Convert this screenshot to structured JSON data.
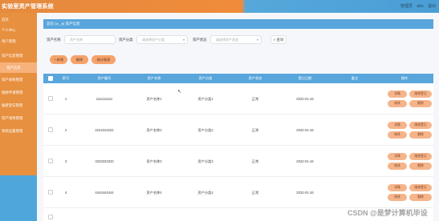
{
  "app": {
    "title": "实验室资产管理系统"
  },
  "user": {
    "role": "管理员",
    "name": "abo",
    "logout": "退出"
  },
  "sidebar": {
    "items": [
      {
        "label": "首页"
      },
      {
        "label": "个人中心"
      },
      {
        "label": "用户管理"
      },
      {
        "label": "资产信息管理"
      },
      {
        "label": "资产信息"
      },
      {
        "label": "资产采购管理"
      },
      {
        "label": "维修申请管理"
      },
      {
        "label": "报废登记管理"
      },
      {
        "label": "资产领用管理"
      },
      {
        "label": "系统设置管理"
      }
    ]
  },
  "breadcrumb": {
    "text": "首页 (◕‿◕) 资产信息"
  },
  "filters": {
    "name_label": "资产名称",
    "name_placeholder": "资产名称",
    "category_label": "资产分类",
    "category_placeholder": "请选择资产分类",
    "status_label": "资产状态",
    "status_placeholder": "请选择资产状态",
    "search_label": "查询"
  },
  "actions": {
    "add": "+ 新增",
    "delete": "删除",
    "report": "统计报表"
  },
  "table": {
    "headers": [
      "索引",
      "资产编号",
      "资产名称",
      "资产分类",
      "资产状态",
      "登记日期",
      "备注",
      "操作"
    ],
    "rows": [
      {
        "index": "1",
        "code": "1111111111",
        "name": "资产名称1",
        "category": "资产分类1",
        "status": "正常",
        "date": "2022-01-16"
      },
      {
        "index": "2",
        "code": "2222222222",
        "name": "资产名称2",
        "category": "资产分类2",
        "status": "正常",
        "date": "2022-01-16"
      },
      {
        "index": "3",
        "code": "3333333333",
        "name": "资产名称3",
        "category": "资产分类3",
        "status": "正常",
        "date": "2022-01-16"
      },
      {
        "index": "4",
        "code": "4444444444",
        "name": "资产名称4",
        "category": "资产分类4",
        "status": "正常",
        "date": "2022-01-16"
      }
    ],
    "ops": {
      "detail": "详情",
      "repair": "维修登记",
      "edit": "修改",
      "delete": "删除"
    }
  },
  "watermark": {
    "text": "CSDN @是梦计算机毕设"
  },
  "colors": {
    "orange": "#e7903f",
    "blue": "#58a6dc",
    "pill": "#f6b48a"
  }
}
